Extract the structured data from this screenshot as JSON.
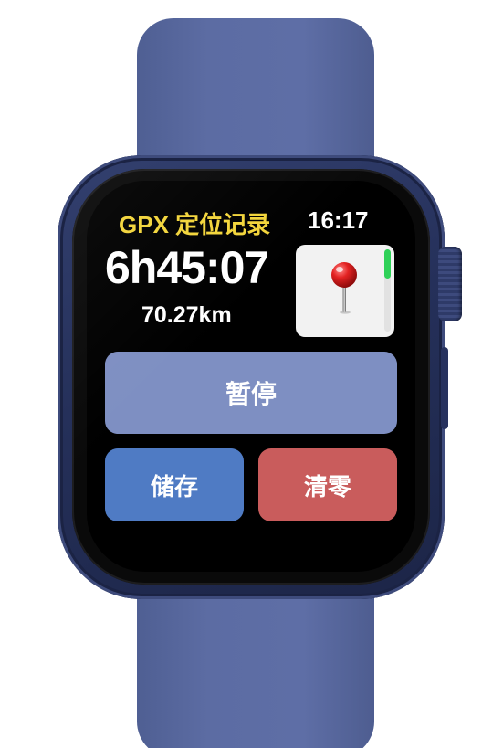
{
  "app": {
    "title": "GPX 定位记录",
    "clock": "16:17"
  },
  "tracking": {
    "elapsed_time": "6h45:07",
    "distance": "70.27km"
  },
  "map": {
    "icon": "map-pin-icon",
    "scroll_indicator_color": "#2fd158"
  },
  "buttons": {
    "pause_label": "暂停",
    "save_label": "储存",
    "reset_label": "清零"
  },
  "colors": {
    "title": "#f3d53b",
    "pause_button": "#7e8fc2",
    "save_button": "#4f7bc4",
    "reset_button": "#c95c5c",
    "watch_band": "#5c6ca3"
  }
}
